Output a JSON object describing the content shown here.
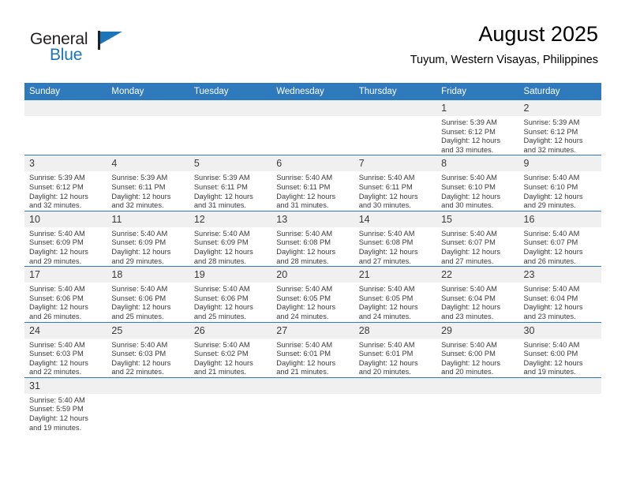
{
  "brand": {
    "name_part1": "General",
    "name_part2": "Blue",
    "accent_color": "#1b75bb"
  },
  "header": {
    "title": "August 2025",
    "subtitle": "Tuyum, Western Visayas, Philippines"
  },
  "theme": {
    "header_row_bg": "#2f79bd",
    "daynum_bg": "#f0f0f0",
    "text_color": "#3a3a3a"
  },
  "weekday_headers": [
    "Sunday",
    "Monday",
    "Tuesday",
    "Wednesday",
    "Thursday",
    "Friday",
    "Saturday"
  ],
  "weeks": [
    [
      {
        "day": "",
        "sunrise": "",
        "sunset": "",
        "daylight_line1": "",
        "daylight_line2": "",
        "empty": true
      },
      {
        "day": "",
        "sunrise": "",
        "sunset": "",
        "daylight_line1": "",
        "daylight_line2": "",
        "empty": true
      },
      {
        "day": "",
        "sunrise": "",
        "sunset": "",
        "daylight_line1": "",
        "daylight_line2": "",
        "empty": true
      },
      {
        "day": "",
        "sunrise": "",
        "sunset": "",
        "daylight_line1": "",
        "daylight_line2": "",
        "empty": true
      },
      {
        "day": "",
        "sunrise": "",
        "sunset": "",
        "daylight_line1": "",
        "daylight_line2": "",
        "empty": true
      },
      {
        "day": "1",
        "sunrise": "Sunrise: 5:39 AM",
        "sunset": "Sunset: 6:12 PM",
        "daylight_line1": "Daylight: 12 hours",
        "daylight_line2": "and 33 minutes."
      },
      {
        "day": "2",
        "sunrise": "Sunrise: 5:39 AM",
        "sunset": "Sunset: 6:12 PM",
        "daylight_line1": "Daylight: 12 hours",
        "daylight_line2": "and 32 minutes."
      }
    ],
    [
      {
        "day": "3",
        "sunrise": "Sunrise: 5:39 AM",
        "sunset": "Sunset: 6:12 PM",
        "daylight_line1": "Daylight: 12 hours",
        "daylight_line2": "and 32 minutes."
      },
      {
        "day": "4",
        "sunrise": "Sunrise: 5:39 AM",
        "sunset": "Sunset: 6:11 PM",
        "daylight_line1": "Daylight: 12 hours",
        "daylight_line2": "and 32 minutes."
      },
      {
        "day": "5",
        "sunrise": "Sunrise: 5:39 AM",
        "sunset": "Sunset: 6:11 PM",
        "daylight_line1": "Daylight: 12 hours",
        "daylight_line2": "and 31 minutes."
      },
      {
        "day": "6",
        "sunrise": "Sunrise: 5:40 AM",
        "sunset": "Sunset: 6:11 PM",
        "daylight_line1": "Daylight: 12 hours",
        "daylight_line2": "and 31 minutes."
      },
      {
        "day": "7",
        "sunrise": "Sunrise: 5:40 AM",
        "sunset": "Sunset: 6:11 PM",
        "daylight_line1": "Daylight: 12 hours",
        "daylight_line2": "and 30 minutes."
      },
      {
        "day": "8",
        "sunrise": "Sunrise: 5:40 AM",
        "sunset": "Sunset: 6:10 PM",
        "daylight_line1": "Daylight: 12 hours",
        "daylight_line2": "and 30 minutes."
      },
      {
        "day": "9",
        "sunrise": "Sunrise: 5:40 AM",
        "sunset": "Sunset: 6:10 PM",
        "daylight_line1": "Daylight: 12 hours",
        "daylight_line2": "and 29 minutes."
      }
    ],
    [
      {
        "day": "10",
        "sunrise": "Sunrise: 5:40 AM",
        "sunset": "Sunset: 6:09 PM",
        "daylight_line1": "Daylight: 12 hours",
        "daylight_line2": "and 29 minutes."
      },
      {
        "day": "11",
        "sunrise": "Sunrise: 5:40 AM",
        "sunset": "Sunset: 6:09 PM",
        "daylight_line1": "Daylight: 12 hours",
        "daylight_line2": "and 29 minutes."
      },
      {
        "day": "12",
        "sunrise": "Sunrise: 5:40 AM",
        "sunset": "Sunset: 6:09 PM",
        "daylight_line1": "Daylight: 12 hours",
        "daylight_line2": "and 28 minutes."
      },
      {
        "day": "13",
        "sunrise": "Sunrise: 5:40 AM",
        "sunset": "Sunset: 6:08 PM",
        "daylight_line1": "Daylight: 12 hours",
        "daylight_line2": "and 28 minutes."
      },
      {
        "day": "14",
        "sunrise": "Sunrise: 5:40 AM",
        "sunset": "Sunset: 6:08 PM",
        "daylight_line1": "Daylight: 12 hours",
        "daylight_line2": "and 27 minutes."
      },
      {
        "day": "15",
        "sunrise": "Sunrise: 5:40 AM",
        "sunset": "Sunset: 6:07 PM",
        "daylight_line1": "Daylight: 12 hours",
        "daylight_line2": "and 27 minutes."
      },
      {
        "day": "16",
        "sunrise": "Sunrise: 5:40 AM",
        "sunset": "Sunset: 6:07 PM",
        "daylight_line1": "Daylight: 12 hours",
        "daylight_line2": "and 26 minutes."
      }
    ],
    [
      {
        "day": "17",
        "sunrise": "Sunrise: 5:40 AM",
        "sunset": "Sunset: 6:06 PM",
        "daylight_line1": "Daylight: 12 hours",
        "daylight_line2": "and 26 minutes."
      },
      {
        "day": "18",
        "sunrise": "Sunrise: 5:40 AM",
        "sunset": "Sunset: 6:06 PM",
        "daylight_line1": "Daylight: 12 hours",
        "daylight_line2": "and 25 minutes."
      },
      {
        "day": "19",
        "sunrise": "Sunrise: 5:40 AM",
        "sunset": "Sunset: 6:06 PM",
        "daylight_line1": "Daylight: 12 hours",
        "daylight_line2": "and 25 minutes."
      },
      {
        "day": "20",
        "sunrise": "Sunrise: 5:40 AM",
        "sunset": "Sunset: 6:05 PM",
        "daylight_line1": "Daylight: 12 hours",
        "daylight_line2": "and 24 minutes."
      },
      {
        "day": "21",
        "sunrise": "Sunrise: 5:40 AM",
        "sunset": "Sunset: 6:05 PM",
        "daylight_line1": "Daylight: 12 hours",
        "daylight_line2": "and 24 minutes."
      },
      {
        "day": "22",
        "sunrise": "Sunrise: 5:40 AM",
        "sunset": "Sunset: 6:04 PM",
        "daylight_line1": "Daylight: 12 hours",
        "daylight_line2": "and 23 minutes."
      },
      {
        "day": "23",
        "sunrise": "Sunrise: 5:40 AM",
        "sunset": "Sunset: 6:04 PM",
        "daylight_line1": "Daylight: 12 hours",
        "daylight_line2": "and 23 minutes."
      }
    ],
    [
      {
        "day": "24",
        "sunrise": "Sunrise: 5:40 AM",
        "sunset": "Sunset: 6:03 PM",
        "daylight_line1": "Daylight: 12 hours",
        "daylight_line2": "and 22 minutes."
      },
      {
        "day": "25",
        "sunrise": "Sunrise: 5:40 AM",
        "sunset": "Sunset: 6:03 PM",
        "daylight_line1": "Daylight: 12 hours",
        "daylight_line2": "and 22 minutes."
      },
      {
        "day": "26",
        "sunrise": "Sunrise: 5:40 AM",
        "sunset": "Sunset: 6:02 PM",
        "daylight_line1": "Daylight: 12 hours",
        "daylight_line2": "and 21 minutes."
      },
      {
        "day": "27",
        "sunrise": "Sunrise: 5:40 AM",
        "sunset": "Sunset: 6:01 PM",
        "daylight_line1": "Daylight: 12 hours",
        "daylight_line2": "and 21 minutes."
      },
      {
        "day": "28",
        "sunrise": "Sunrise: 5:40 AM",
        "sunset": "Sunset: 6:01 PM",
        "daylight_line1": "Daylight: 12 hours",
        "daylight_line2": "and 20 minutes."
      },
      {
        "day": "29",
        "sunrise": "Sunrise: 5:40 AM",
        "sunset": "Sunset: 6:00 PM",
        "daylight_line1": "Daylight: 12 hours",
        "daylight_line2": "and 20 minutes."
      },
      {
        "day": "30",
        "sunrise": "Sunrise: 5:40 AM",
        "sunset": "Sunset: 6:00 PM",
        "daylight_line1": "Daylight: 12 hours",
        "daylight_line2": "and 19 minutes."
      }
    ],
    [
      {
        "day": "31",
        "sunrise": "Sunrise: 5:40 AM",
        "sunset": "Sunset: 5:59 PM",
        "daylight_line1": "Daylight: 12 hours",
        "daylight_line2": "and 19 minutes."
      },
      {
        "day": "",
        "sunrise": "",
        "sunset": "",
        "daylight_line1": "",
        "daylight_line2": "",
        "empty": true
      },
      {
        "day": "",
        "sunrise": "",
        "sunset": "",
        "daylight_line1": "",
        "daylight_line2": "",
        "empty": true
      },
      {
        "day": "",
        "sunrise": "",
        "sunset": "",
        "daylight_line1": "",
        "daylight_line2": "",
        "empty": true
      },
      {
        "day": "",
        "sunrise": "",
        "sunset": "",
        "daylight_line1": "",
        "daylight_line2": "",
        "empty": true
      },
      {
        "day": "",
        "sunrise": "",
        "sunset": "",
        "daylight_line1": "",
        "daylight_line2": "",
        "empty": true
      },
      {
        "day": "",
        "sunrise": "",
        "sunset": "",
        "daylight_line1": "",
        "daylight_line2": "",
        "empty": true
      }
    ]
  ]
}
